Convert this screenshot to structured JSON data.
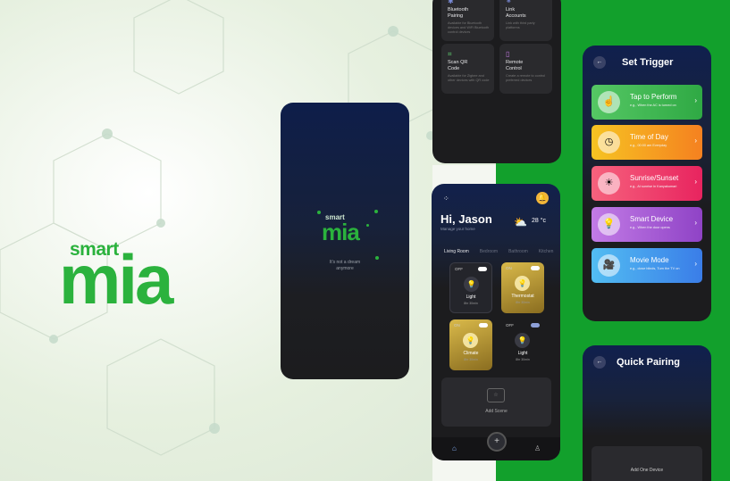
{
  "brand": {
    "smart": "smart",
    "mia": "mia"
  },
  "splash": {
    "tagline_1": "It's not a dream",
    "tagline_2": "anymore"
  },
  "features": [
    {
      "title_1": "Bluetooth",
      "title_2": "Pairing",
      "desc": "Available for Bluetooth devices and WiFi Bluetooth control devices"
    },
    {
      "title_1": "Link",
      "title_2": "Accounts",
      "desc": "Link with third party platforms"
    },
    {
      "title_1": "Scan QR",
      "title_2": "Code",
      "desc": "Available for Zigbee and other devices with QR code"
    },
    {
      "title_1": "Remote",
      "title_2": "Control",
      "desc": "Create a remote to control preferred devices"
    }
  ],
  "home": {
    "greeting": "Hi, Jason",
    "subtitle": "Manage your home",
    "temperature": "28 °c",
    "rooms": [
      "Living Room",
      "Bedroom",
      "Bathroom",
      "Kitchen"
    ],
    "devices": [
      {
        "state": "OFF",
        "name": "Light",
        "runtime": "8hr 30min",
        "on": false
      },
      {
        "state": "ON",
        "name": "Thermostat",
        "runtime": "8hr 30min",
        "on": true
      },
      {
        "state": "ON",
        "name": "Climate",
        "runtime": "8hr 30min",
        "on": true
      },
      {
        "state": "OFF",
        "name": "Light",
        "runtime": "8hr 30min",
        "on": false
      }
    ],
    "add_scene": "Add Scene"
  },
  "trigger": {
    "title": "Set Trigger",
    "items": [
      {
        "title": "Tap to Perform",
        "desc": "e.g., When the AC is turned on",
        "color": "#3fbf4e"
      },
      {
        "title": "Time of Day",
        "desc": "e.g., 00:00 am Everyday",
        "color": "#f59a1e"
      },
      {
        "title": "Sunrise/Sunset",
        "desc": "e.g., At sunrise in Kanyakumari",
        "color": "#ee3f74"
      },
      {
        "title": "Smart Device",
        "desc": "e.g., When the door opens",
        "color": "#a04fcf"
      },
      {
        "title": "Movie Mode",
        "desc": "e.g., close blinds, Turn the TV on",
        "color": "#3d8ef0"
      }
    ]
  },
  "pairing": {
    "title": "Quick Pairing",
    "add_device": "Add One Device"
  }
}
